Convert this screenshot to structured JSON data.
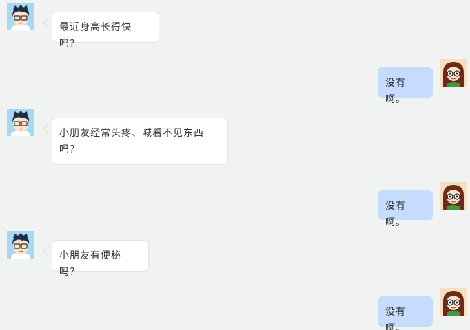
{
  "conversation": {
    "messages": [
      {
        "sender": "doctor",
        "text": "最近身高长得快吗？"
      },
      {
        "sender": "patient",
        "text": "没有啊。"
      },
      {
        "sender": "doctor",
        "text": "小朋友经常头疼、喊看不见东西吗？"
      },
      {
        "sender": "patient",
        "text": "没有啊。"
      },
      {
        "sender": "doctor",
        "text": "小朋友有便秘吗？"
      },
      {
        "sender": "patient",
        "text": "没有啊。"
      }
    ]
  },
  "avatars": {
    "doctor_icon": "boy-with-glasses-avatar-icon",
    "patient_icon": "girl-with-glasses-avatar-icon"
  },
  "colors": {
    "background": "#f1f2f2",
    "left_bubble": "#ffffff",
    "right_bubble": "#c6dcff",
    "text": "#333333"
  }
}
